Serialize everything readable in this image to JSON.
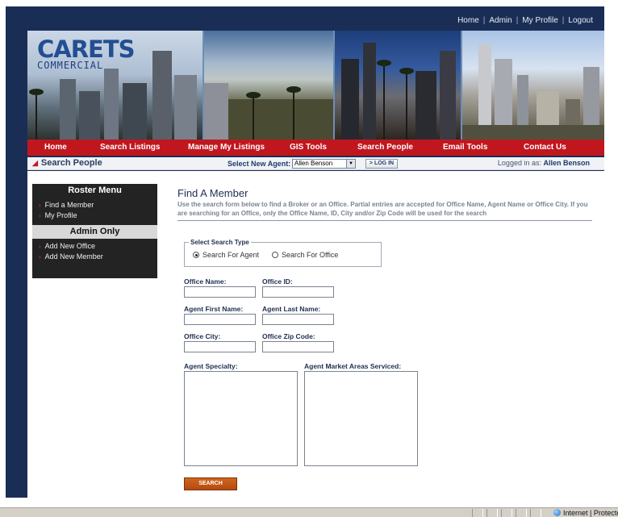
{
  "top_nav": [
    "Home",
    "Admin",
    "My Profile",
    "Logout"
  ],
  "logo": {
    "main": "CARETS",
    "sub": "COMMERCIAL"
  },
  "main_nav": [
    "Home",
    "Search Listings",
    "Manage My Listings",
    "GIS Tools",
    "Search People",
    "Email Tools",
    "Contact Us"
  ],
  "subbar": {
    "section_title": "Search People",
    "select_agent_label": "Select New Agent:",
    "selected_agent": "Allen Benson",
    "login_button": "LOG IN",
    "logged_in_label": "Logged in as:",
    "logged_in_user": "Allen Benson"
  },
  "sidebar": {
    "roster_title": "Roster Menu",
    "roster_items": [
      "Find a Member",
      "My Profile"
    ],
    "admin_title": "Admin Only",
    "admin_items": [
      "Add New Office",
      "Add New Member"
    ]
  },
  "main": {
    "title": "Find A Member",
    "description": "Use the search form below to find a Broker or an Office. Partial entries are accepted for Office Name, Agent Name or Office City. If you are searching for an Office, only the Office Name, ID, City and/or Zip Code will be used for the search"
  },
  "search_type": {
    "legend": "Select Search Type",
    "options": [
      "Search For Agent",
      "Search For Office"
    ],
    "selected": "Search For Agent"
  },
  "fields": {
    "office_name": "Office Name:",
    "office_id": "Office ID:",
    "agent_first": "Agent First Name:",
    "agent_last": "Agent Last Name:",
    "office_city": "Office City:",
    "office_zip": "Office Zip Code:",
    "specialty": "Agent Specialty:",
    "market_areas": "Agent Market Areas Serviced:"
  },
  "search_button": "SEARCH",
  "status_bar": {
    "zone": "Internet | Protecte"
  },
  "colors": {
    "frame": "#1a2e55",
    "nav_red": "#c0171f",
    "accent_orange": "#c65a18",
    "sidebar_dark": "#232323"
  }
}
